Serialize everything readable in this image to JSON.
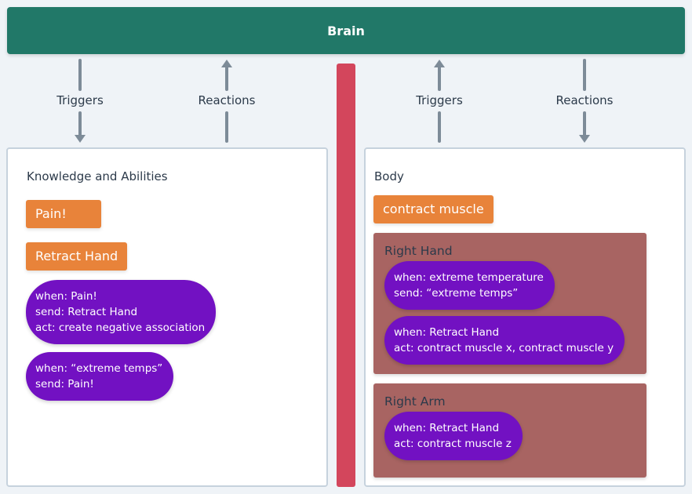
{
  "brain": {
    "label": "Brain"
  },
  "colors": {
    "brain": "#217868",
    "divider": "#d3465c",
    "message": "#e8833a",
    "rule": "#7211c2",
    "body_part": "#a86462",
    "arrow": "#7d8b98"
  },
  "connectors": [
    {
      "label": "Triggers",
      "direction": "down"
    },
    {
      "label": "Reactions",
      "direction": "up"
    },
    {
      "label": "Triggers",
      "direction": "up"
    },
    {
      "label": "Reactions",
      "direction": "down"
    }
  ],
  "left_panel": {
    "title": "Knowledge and Abilities",
    "messages": [
      "Pain!",
      "Retract Hand"
    ],
    "rules": [
      {
        "lines": [
          "when: Pain!",
          "send: Retract Hand",
          "act: create negative association"
        ]
      },
      {
        "lines": [
          "when: “extreme temps”",
          "send: Pain!"
        ]
      }
    ]
  },
  "right_panel": {
    "title": "Body",
    "messages": [
      "contract muscle"
    ],
    "parts": [
      {
        "title": "Right Hand",
        "rules": [
          {
            "lines": [
              "when: extreme temperature",
              "send: “extreme temps”"
            ]
          },
          {
            "lines": [
              "when: Retract Hand",
              "act: contract muscle x, contract muscle y"
            ]
          }
        ]
      },
      {
        "title": "Right Arm",
        "rules": [
          {
            "lines": [
              "when: Retract Hand",
              "act: contract muscle z"
            ]
          }
        ]
      }
    ]
  }
}
